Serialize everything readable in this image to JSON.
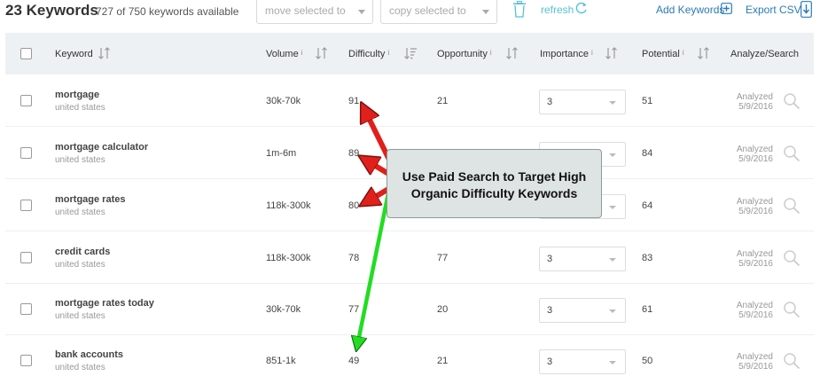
{
  "toolbar": {
    "keywords_count": "23 Keywords",
    "available": "727 of 750 keywords available",
    "move_placeholder": "move selected to",
    "copy_placeholder": "copy selected to",
    "refresh": "refresh",
    "add_keywords": "Add Keywords",
    "export_csv": "Export CSV"
  },
  "columns": {
    "keyword": "Keyword",
    "volume": "Volume",
    "difficulty": "Difficulty",
    "opportunity": "Opportunity",
    "importance": "Importance",
    "potential": "Potential",
    "analyze": "Analyze/Search",
    "info_mark": "i"
  },
  "rows": [
    {
      "keyword": "mortgage",
      "location": "united states",
      "volume": "30k-70k",
      "difficulty": "91",
      "opportunity": "21",
      "importance": "3",
      "potential": "51",
      "status": "Analyzed",
      "date": "5/9/2016"
    },
    {
      "keyword": "mortgage calculator",
      "location": "united states",
      "volume": "1m-6m",
      "difficulty": "89",
      "opportunity": "",
      "importance": "",
      "potential": "84",
      "status": "Analyzed",
      "date": "5/9/2016"
    },
    {
      "keyword": "mortgage rates",
      "location": "united states",
      "volume": "118k-300k",
      "difficulty": "80",
      "opportunity": "",
      "importance": "",
      "potential": "64",
      "status": "Analyzed",
      "date": "5/9/2016"
    },
    {
      "keyword": "credit cards",
      "location": "united states",
      "volume": "118k-300k",
      "difficulty": "78",
      "opportunity": "77",
      "importance": "3",
      "potential": "83",
      "status": "Analyzed",
      "date": "5/9/2016"
    },
    {
      "keyword": "mortgage rates today",
      "location": "united states",
      "volume": "30k-70k",
      "difficulty": "77",
      "opportunity": "20",
      "importance": "3",
      "potential": "61",
      "status": "Analyzed",
      "date": "5/9/2016"
    },
    {
      "keyword": "bank accounts",
      "location": "united states",
      "volume": "851-1k",
      "difficulty": "49",
      "opportunity": "21",
      "importance": "3",
      "potential": "50",
      "status": "Analyzed",
      "date": "5/9/2016"
    }
  ],
  "callout": {
    "line1": "Use Paid Search to Target High",
    "line2": "Organic Difficulty Keywords"
  },
  "colors": {
    "accent_link": "#2a7bb6",
    "refresh": "#55c1d9",
    "header_bg": "#eef1f3",
    "arrow_red": "#e0201b",
    "arrow_green": "#22dd22"
  },
  "icons": {
    "trash": "trash-icon",
    "refresh": "refresh-icon",
    "add": "plus-square-icon",
    "export": "download-icon",
    "sort": "sort-icon",
    "search": "magnifier-icon"
  }
}
